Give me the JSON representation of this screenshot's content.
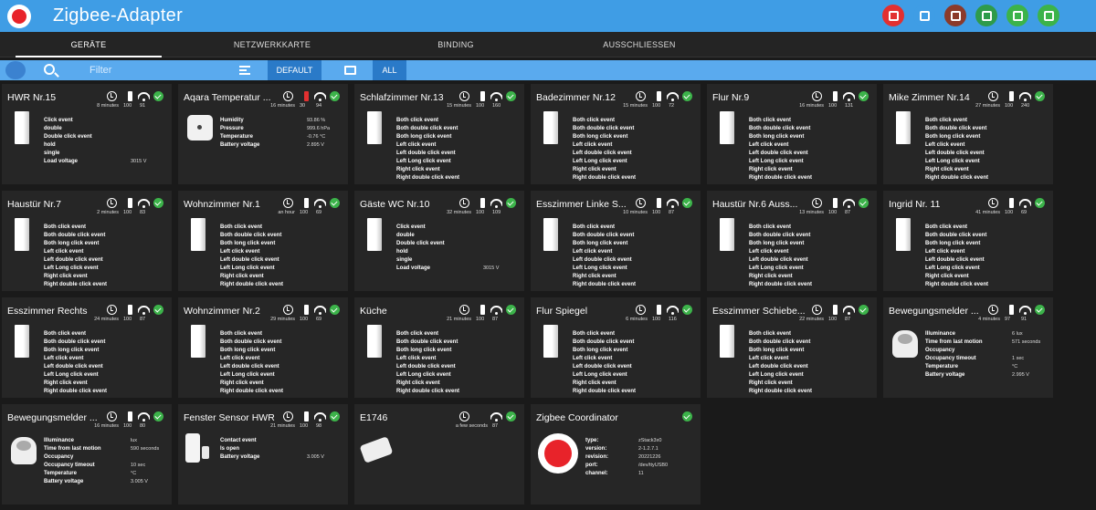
{
  "app": {
    "title": "Zigbee-Adapter",
    "colors": {
      "header": "#3f9de5",
      "ok": "#3cb34a",
      "low_battery": "#e23030"
    }
  },
  "toolbar": {
    "buttons": [
      {
        "name": "refresh-icon",
        "color": "#e23030"
      },
      {
        "name": "device-icon",
        "color": "#3f9de5"
      },
      {
        "name": "cookie-icon",
        "color": "#8b3a2a"
      },
      {
        "name": "signal-icon",
        "color": "#2e9b4a"
      },
      {
        "name": "chip-icon",
        "color": "#3cb34a"
      },
      {
        "name": "settings-icon",
        "color": "#3cb34a"
      }
    ]
  },
  "tabs": [
    "GERÄTE",
    "NETZWERKKARTE",
    "BINDING",
    "AUSSCHLIESSEN"
  ],
  "filter": {
    "placeholder": "Filter",
    "default_label": "DEFAULT",
    "all_label": "ALL"
  },
  "devices": [
    {
      "name": "HWR Nr.15",
      "time": "8 minutes",
      "battery": "100",
      "link": "91",
      "img": "switch",
      "states": [
        [
          "Click event",
          ""
        ],
        [
          "double",
          ""
        ],
        [
          "Double click event",
          ""
        ],
        [
          "hold",
          ""
        ],
        [
          "single",
          ""
        ],
        [
          "Load voltage",
          "3015 V"
        ]
      ]
    },
    {
      "name": "Aqara Temperatur ...",
      "time": "16 minutes",
      "battery": "30",
      "low": true,
      "link": "94",
      "img": "square",
      "states": [
        [
          "Humidity",
          "93.86 %"
        ],
        [
          "Pressure",
          "999.6 hPa"
        ],
        [
          "Temperature",
          "-0.76 °C"
        ],
        [
          "Battery voltage",
          "2.895 V"
        ]
      ]
    },
    {
      "name": "Schlafzimmer Nr.13",
      "time": "15 minutes",
      "battery": "100",
      "link": "160",
      "img": "switch",
      "states": "rocker"
    },
    {
      "name": "Badezimmer Nr.12",
      "time": "15 minutes",
      "battery": "100",
      "link": "72",
      "img": "switch",
      "states": "rocker"
    },
    {
      "name": "Flur Nr.9",
      "time": "16 minutes",
      "battery": "100",
      "link": "131",
      "img": "switch",
      "states": "rocker"
    },
    {
      "name": "Mike Zimmer Nr.14",
      "time": "27 minutes",
      "battery": "100",
      "link": "240",
      "img": "switch",
      "states": "rocker"
    },
    {
      "name": "Haustür Nr.7",
      "time": "2 minutes",
      "battery": "100",
      "link": "83",
      "img": "switch",
      "states": "rocker"
    },
    {
      "name": "Wohnzimmer Nr.1",
      "time": "an hour",
      "battery": "100",
      "link": "69",
      "img": "switch",
      "states": "rocker"
    },
    {
      "name": "Gäste WC Nr.10",
      "time": "32 minutes",
      "battery": "100",
      "link": "109",
      "img": "switch",
      "states": [
        [
          "Click event",
          ""
        ],
        [
          "double",
          ""
        ],
        [
          "Double click event",
          ""
        ],
        [
          "hold",
          ""
        ],
        [
          "single",
          ""
        ],
        [
          "Load voltage",
          "3015 V"
        ]
      ]
    },
    {
      "name": "Esszimmer Linke S...",
      "time": "10 minutes",
      "battery": "100",
      "link": "87",
      "img": "switch",
      "states": "rocker"
    },
    {
      "name": "Haustür Nr.6 Auss...",
      "time": "13 minutes",
      "battery": "100",
      "link": "87",
      "img": "switch",
      "states": "rocker"
    },
    {
      "name": "Ingrid Nr. 11",
      "time": "41 minutes",
      "battery": "100",
      "link": "69",
      "img": "switch",
      "states": "rocker"
    },
    {
      "name": "Esszimmer Rechts",
      "time": "24 minutes",
      "battery": "100",
      "link": "87",
      "img": "switch",
      "states": "rocker"
    },
    {
      "name": "Wohnzimmer Nr.2",
      "time": "29 minutes",
      "battery": "100",
      "link": "69",
      "img": "switch",
      "states": "rocker"
    },
    {
      "name": "Küche",
      "time": "21 minutes",
      "battery": "100",
      "link": "87",
      "img": "switch",
      "states": "rocker"
    },
    {
      "name": "Flur Spiegel",
      "time": "6 minutes",
      "battery": "100",
      "link": "116",
      "img": "switch",
      "states": "rocker"
    },
    {
      "name": "Esszimmer Schiebe...",
      "time": "22 minutes",
      "battery": "100",
      "link": "87",
      "img": "switch",
      "states": "rocker"
    },
    {
      "name": "Bewegungsmelder ...",
      "time": "4 minutes",
      "battery": "97",
      "link": "91",
      "img": "motion",
      "states": [
        [
          "Illuminance",
          "6 lux"
        ],
        [
          "Time from last motion",
          "571 seconds"
        ],
        [
          "Occupancy",
          ""
        ],
        [
          "Occupancy timeout",
          "1 sec"
        ],
        [
          "Temperature",
          "°C"
        ],
        [
          "Battery voltage",
          "2.995 V"
        ]
      ]
    },
    {
      "name": "Bewegungsmelder ...",
      "time": "16 minutes",
      "battery": "100",
      "link": "80",
      "img": "motion",
      "states": [
        [
          "Illuminance",
          "lux"
        ],
        [
          "Time from last motion",
          "590 seconds"
        ],
        [
          "Occupancy",
          ""
        ],
        [
          "Occupancy timeout",
          "10 sec"
        ],
        [
          "Temperature",
          "°C"
        ],
        [
          "Battery voltage",
          "3.005 V"
        ]
      ]
    },
    {
      "name": "Fenster Sensor HWR",
      "time": "21 minutes",
      "battery": "100",
      "link": "98",
      "img": "door",
      "states": [
        [
          "Contact event",
          ""
        ],
        [
          "Is open",
          ""
        ],
        [
          "Battery voltage",
          "3.005 V"
        ]
      ]
    },
    {
      "name": "E1746",
      "time": "a few seconds",
      "battery": "",
      "link": "87",
      "img": "plug",
      "states": []
    },
    {
      "name": "Zigbee Coordinator",
      "time": "",
      "battery": "",
      "link": "",
      "img": "zigbee",
      "coord": true,
      "states": [
        [
          "type:",
          "zStack3x0"
        ],
        [
          "version:",
          "2-1.2.7.1"
        ],
        [
          "revision:",
          "20221226"
        ],
        [
          "port:",
          "/dev/ttyUSB0"
        ],
        [
          "channel:",
          "11"
        ]
      ]
    }
  ],
  "rocker_states": [
    "Both click event",
    "Both double click event",
    "Both long click event",
    "Left click event",
    "Left double click event",
    "Left Long click event",
    "Right click event",
    "Right double click event"
  ]
}
